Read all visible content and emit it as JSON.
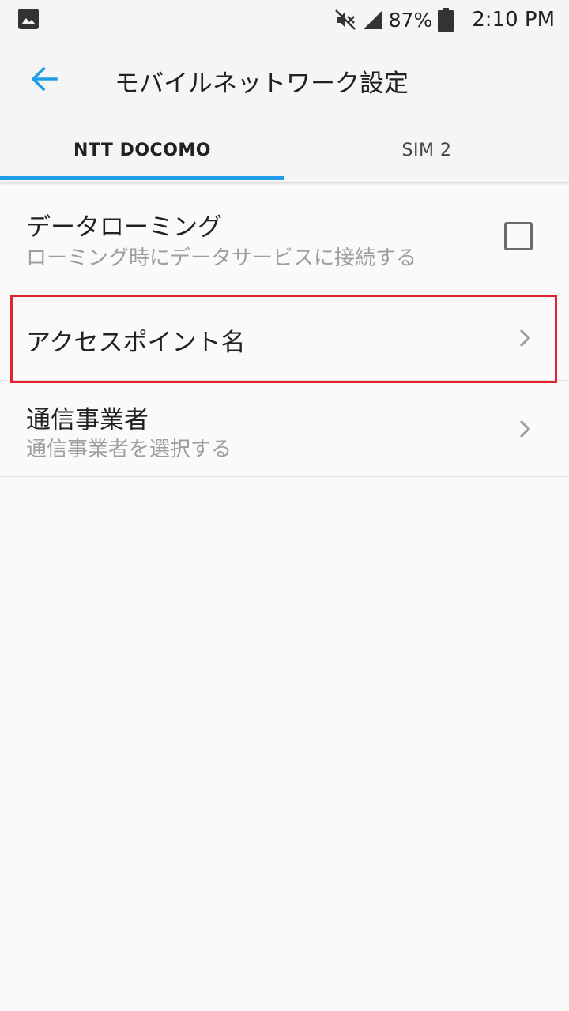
{
  "status_bar": {
    "battery_percent": "87%",
    "time": "2:10 PM",
    "icons": [
      "image-icon",
      "mute-icon",
      "signal-icon",
      "battery-icon"
    ]
  },
  "toolbar": {
    "title": "モバイルネットワーク設定",
    "back_icon": "arrow-left-icon",
    "accent_color": "#1e9be9"
  },
  "tabs": [
    {
      "label": "NTT DOCOMO",
      "selected": true
    },
    {
      "label": "SIM 2",
      "selected": false
    }
  ],
  "settings": {
    "data_roaming": {
      "title": "データローミング",
      "summary": "ローミング時にデータサービスに接続する",
      "checked": false
    },
    "apn": {
      "title": "アクセスポイント名",
      "highlight_color": "#e3232b"
    },
    "carrier": {
      "title": "通信事業者",
      "summary": "通信事業者を選択する"
    }
  }
}
